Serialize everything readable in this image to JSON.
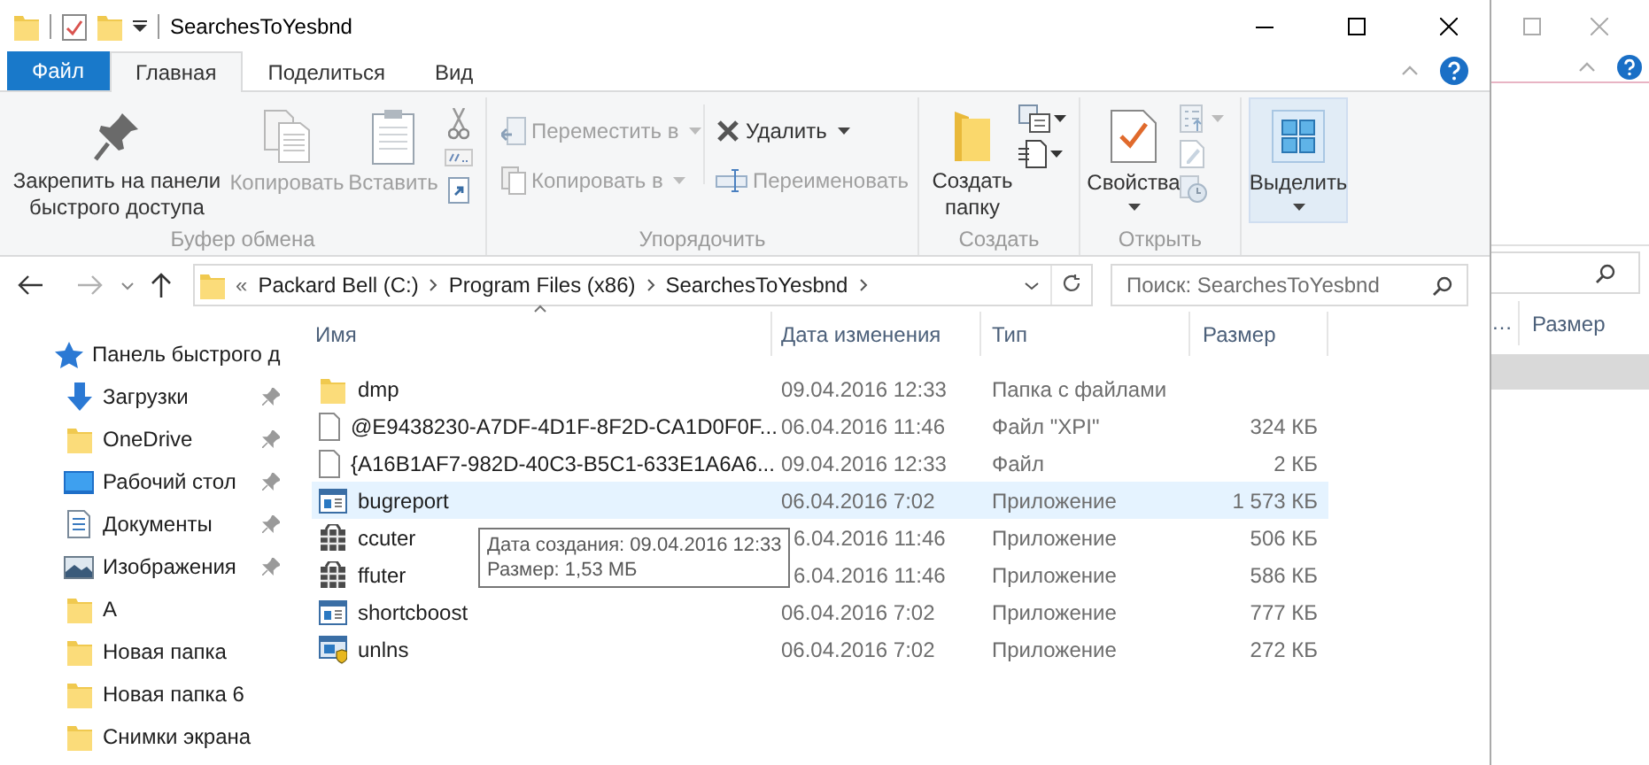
{
  "window": {
    "title": "SearchesToYesbnd"
  },
  "ribbon_tabs": [
    {
      "label": "Файл",
      "kind": "file_menu",
      "selected": false
    },
    {
      "label": "Главная",
      "kind": "tab",
      "selected": true
    },
    {
      "label": "Поделиться",
      "kind": "tab",
      "selected": false
    },
    {
      "label": "Вид",
      "kind": "tab",
      "selected": false
    }
  ],
  "ribbon": {
    "groups": [
      {
        "label": "Буфер обмена",
        "buttons": [
          {
            "label": "Закрепить на панели быстрого доступа",
            "kind": "large",
            "disabled": false,
            "dropdown": false,
            "highlighted": false
          },
          {
            "label": "Копировать",
            "kind": "large",
            "disabled": true,
            "dropdown": false,
            "highlighted": false
          },
          {
            "label": "Вставить",
            "kind": "large",
            "disabled": true,
            "dropdown": false,
            "highlighted": false
          }
        ]
      },
      {
        "label": "Упорядочить",
        "buttons": [
          {
            "label": "Переместить в",
            "kind": "small",
            "disabled": true,
            "dropdown": true,
            "highlighted": false
          },
          {
            "label": "Копировать в",
            "kind": "small",
            "disabled": true,
            "dropdown": true,
            "highlighted": false
          },
          {
            "label": "Удалить",
            "kind": "small",
            "disabled": false,
            "dropdown": true,
            "highlighted": false
          },
          {
            "label": "Переименовать",
            "kind": "small",
            "disabled": true,
            "dropdown": false,
            "highlighted": false
          }
        ]
      },
      {
        "label": "Создать",
        "buttons": [
          {
            "label": "Создать папку",
            "kind": "large",
            "disabled": false,
            "dropdown": false,
            "highlighted": false
          }
        ]
      },
      {
        "label": "Открыть",
        "buttons": [
          {
            "label": "Свойства",
            "kind": "large",
            "disabled": false,
            "dropdown": true,
            "highlighted": false
          }
        ]
      },
      {
        "buttons": [
          {
            "label": "Выделить",
            "kind": "large",
            "disabled": false,
            "dropdown": true,
            "highlighted": true
          }
        ]
      }
    ]
  },
  "address_bar": {
    "overflow": "«",
    "segments": [
      "Packard Bell (C:)",
      "Program Files (x86)",
      "SearchesToYesbnd"
    ]
  },
  "search": {
    "placeholder": "Поиск: SearchesToYesbnd"
  },
  "sidebar": {
    "items": [
      {
        "label": "Панель быстрого д",
        "kind": "quick_access",
        "pinned": false
      },
      {
        "label": "Загрузки",
        "kind": "downloads",
        "pinned": true
      },
      {
        "label": "OneDrive",
        "kind": "folder",
        "pinned": true
      },
      {
        "label": "Рабочий стол",
        "kind": "desktop",
        "pinned": true
      },
      {
        "label": "Документы",
        "kind": "documents",
        "pinned": true
      },
      {
        "label": "Изображения",
        "kind": "pictures",
        "pinned": true
      },
      {
        "label": "A",
        "kind": "folder",
        "pinned": false
      },
      {
        "label": "Новая папка",
        "kind": "folder",
        "pinned": false
      },
      {
        "label": "Новая папка 6",
        "kind": "folder",
        "pinned": false
      },
      {
        "label": "Снимки экрана",
        "kind": "folder",
        "pinned": false
      }
    ]
  },
  "file_list": {
    "columns": [
      {
        "label": "Имя",
        "sorted": true
      },
      {
        "label": "Дата изменения",
        "sorted": false
      },
      {
        "label": "Тип",
        "sorted": false
      },
      {
        "label": "Размер",
        "sorted": false
      }
    ],
    "rows": [
      {
        "name": "dmp",
        "date": "09.04.2016 12:33",
        "type": "Папка с файлами",
        "size": "",
        "kind": "folder",
        "selected": false,
        "date_covered": false
      },
      {
        "name": "@E9438230-A7DF-4D1F-8F2D-CA1D0F0F...",
        "date": "06.04.2016 11:46",
        "type": "Файл \"XPI\"",
        "size": "324 КБ",
        "kind": "file",
        "selected": false,
        "date_covered": false
      },
      {
        "name": "{A16B1AF7-982D-40C3-B5C1-633E1A6A6...",
        "date": "09.04.2016 12:33",
        "type": "Файл",
        "size": "2 КБ",
        "kind": "file",
        "selected": false,
        "date_covered": false
      },
      {
        "name": "bugreport",
        "date": "06.04.2016 7:02",
        "type": "Приложение",
        "size": "1 573 КБ",
        "kind": "app",
        "selected": true,
        "date_covered": false
      },
      {
        "name": "ccuter",
        "date": "6.04.2016 11:46",
        "type": "Приложение",
        "size": "506 КБ",
        "kind": "package",
        "selected": false,
        "date_covered": true
      },
      {
        "name": "ffuter",
        "date": "6.04.2016 11:46",
        "type": "Приложение",
        "size": "586 КБ",
        "kind": "package",
        "selected": false,
        "date_covered": true
      },
      {
        "name": "shortcboost",
        "date": "06.04.2016 7:02",
        "type": "Приложение",
        "size": "777 КБ",
        "kind": "app",
        "selected": false,
        "date_covered": false
      },
      {
        "name": "unlns",
        "date": "06.04.2016 7:02",
        "type": "Приложение",
        "size": "272 КБ",
        "kind": "installer",
        "selected": false,
        "date_covered": false
      }
    ],
    "tooltip": {
      "lines": [
        "Дата создания: 09.04.2016 12:33",
        "Размер: 1,53 МБ"
      ]
    }
  },
  "background_window": {
    "column_headers": [
      "…",
      "Размер"
    ]
  }
}
